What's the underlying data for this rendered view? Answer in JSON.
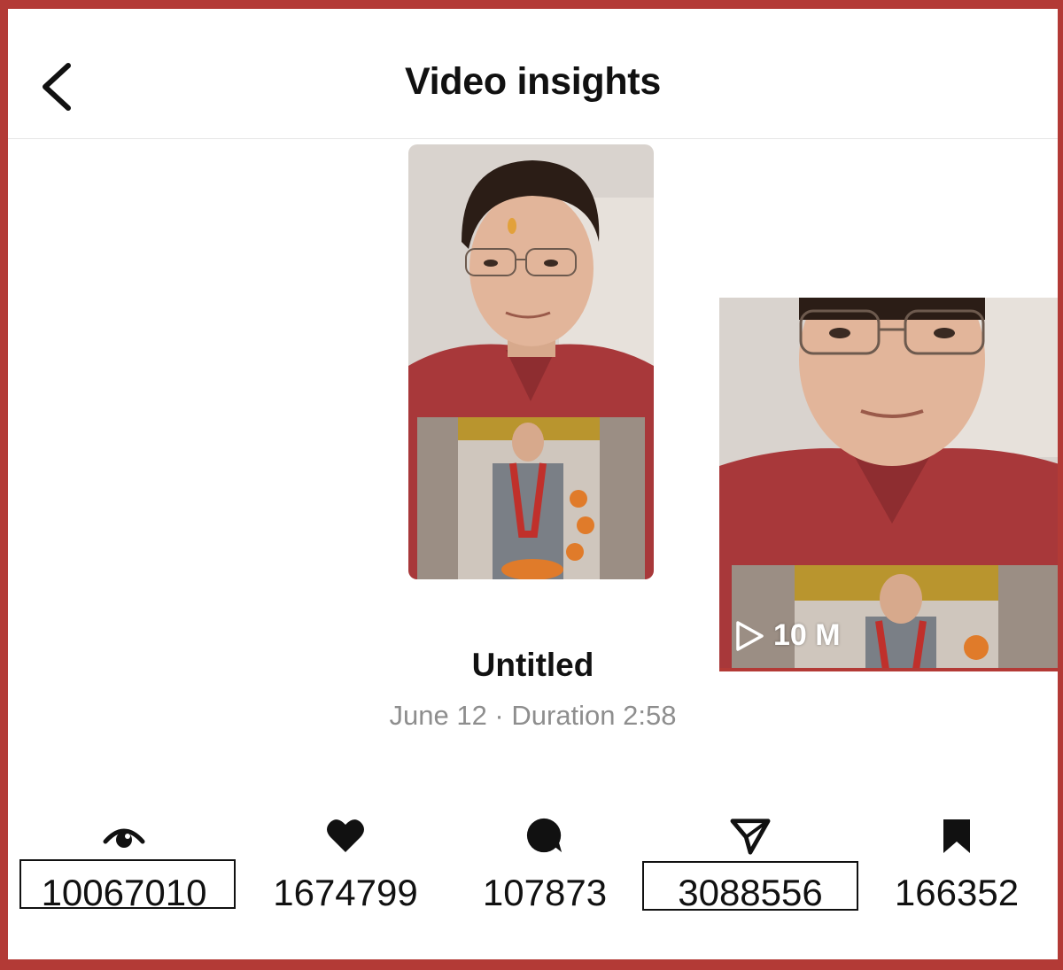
{
  "header": {
    "title": "Video insights",
    "back_icon": "chevron-left-icon"
  },
  "video": {
    "title": "Untitled",
    "meta": "June 12 · Duration 2:58",
    "zoom_views": "10 M",
    "play_icon": "play-icon"
  },
  "stats": [
    {
      "icon": "eye-icon",
      "value": "10067010",
      "highlighted": true
    },
    {
      "icon": "heart-icon",
      "value": "1674799",
      "highlighted": false
    },
    {
      "icon": "comment-icon",
      "value": "107873",
      "highlighted": false
    },
    {
      "icon": "send-icon",
      "value": "3088556",
      "highlighted": true
    },
    {
      "icon": "bookmark-icon",
      "value": "166352",
      "highlighted": false
    }
  ],
  "colors": {
    "frame_border": "#b33a36",
    "text_primary": "#111111",
    "text_secondary": "#8e8e8e"
  }
}
